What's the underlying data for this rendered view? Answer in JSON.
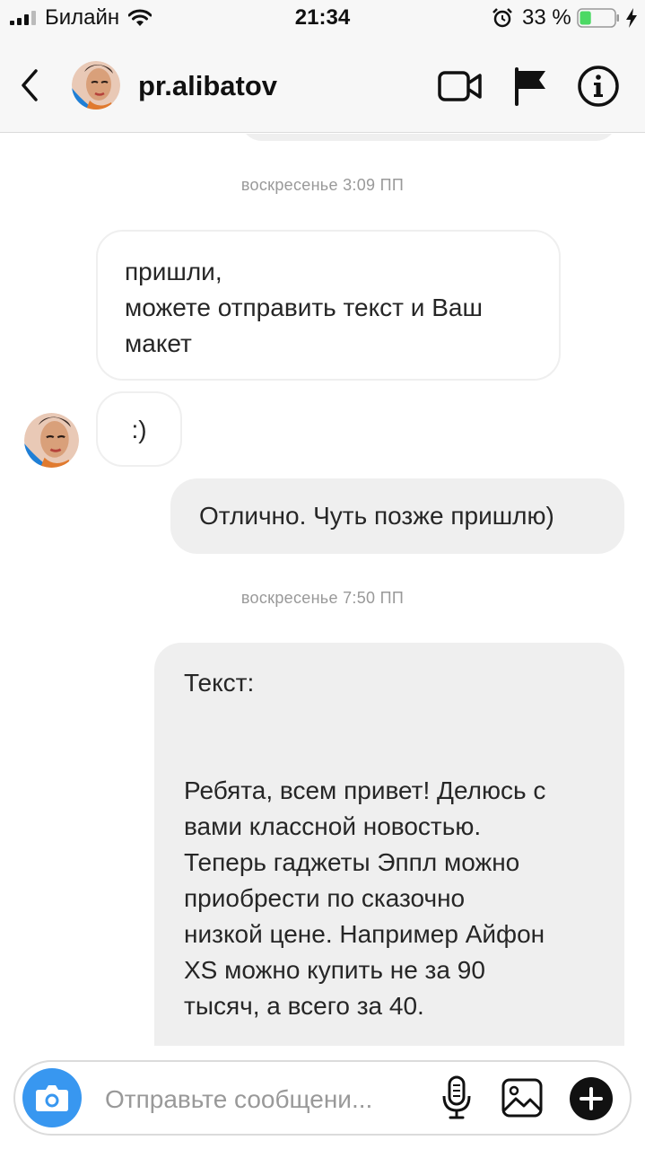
{
  "status_bar": {
    "carrier": "Билайн",
    "time": "21:34",
    "battery_percent": "33 %",
    "battery_level": 0.33
  },
  "header": {
    "username": "pr.alibatov"
  },
  "icons": {
    "back": "chevron-left-icon",
    "video": "video-camera-icon",
    "flag": "flag-icon",
    "info": "info-icon",
    "camera": "camera-icon",
    "mic": "microphone-icon",
    "gallery": "image-icon",
    "plus": "plus-icon"
  },
  "colors": {
    "accent": "#3897f0",
    "outgoing_bubble": "#efefef",
    "battery": "#4cd964"
  },
  "chat": {
    "messages": [
      {
        "type": "timestamp",
        "text": "воскресенье 3:09 ПП"
      },
      {
        "type": "incoming",
        "text": "пришли,\nможете отправить текст и Ваш\nмакет"
      },
      {
        "type": "incoming",
        "text": ":)"
      },
      {
        "type": "outgoing",
        "text": "Отлично. Чуть позже пришлю)"
      },
      {
        "type": "timestamp",
        "text": "воскресенье 7:50 ПП"
      },
      {
        "type": "outgoing",
        "text": "Текст:\n\n\nРебята, всем привет! Делюсь с\nвами классной новостью.\nТеперь гаджеты Эппл можно\nприобрести по сказочно\nнизкой цене. Например Айфон\nXS можно купить не за 90\nтысяч, а всего за 40."
      }
    ]
  },
  "composer": {
    "placeholder": "Отправьте сообщени..."
  }
}
